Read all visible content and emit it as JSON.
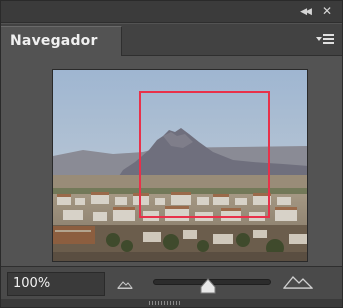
{
  "panel": {
    "tab_label": "Navegador",
    "collapse_icon": "double-chevron-left-icon",
    "close_icon": "close-icon",
    "menu_icon": "panel-menu-icon"
  },
  "zoom": {
    "value_label": "100%",
    "slider_level": 0.47,
    "zoom_out_icon": "small-mountains-icon",
    "zoom_in_icon": "large-mountains-icon"
  },
  "colors": {
    "view_box": "#e8314a",
    "panel_bg": "#535353"
  }
}
